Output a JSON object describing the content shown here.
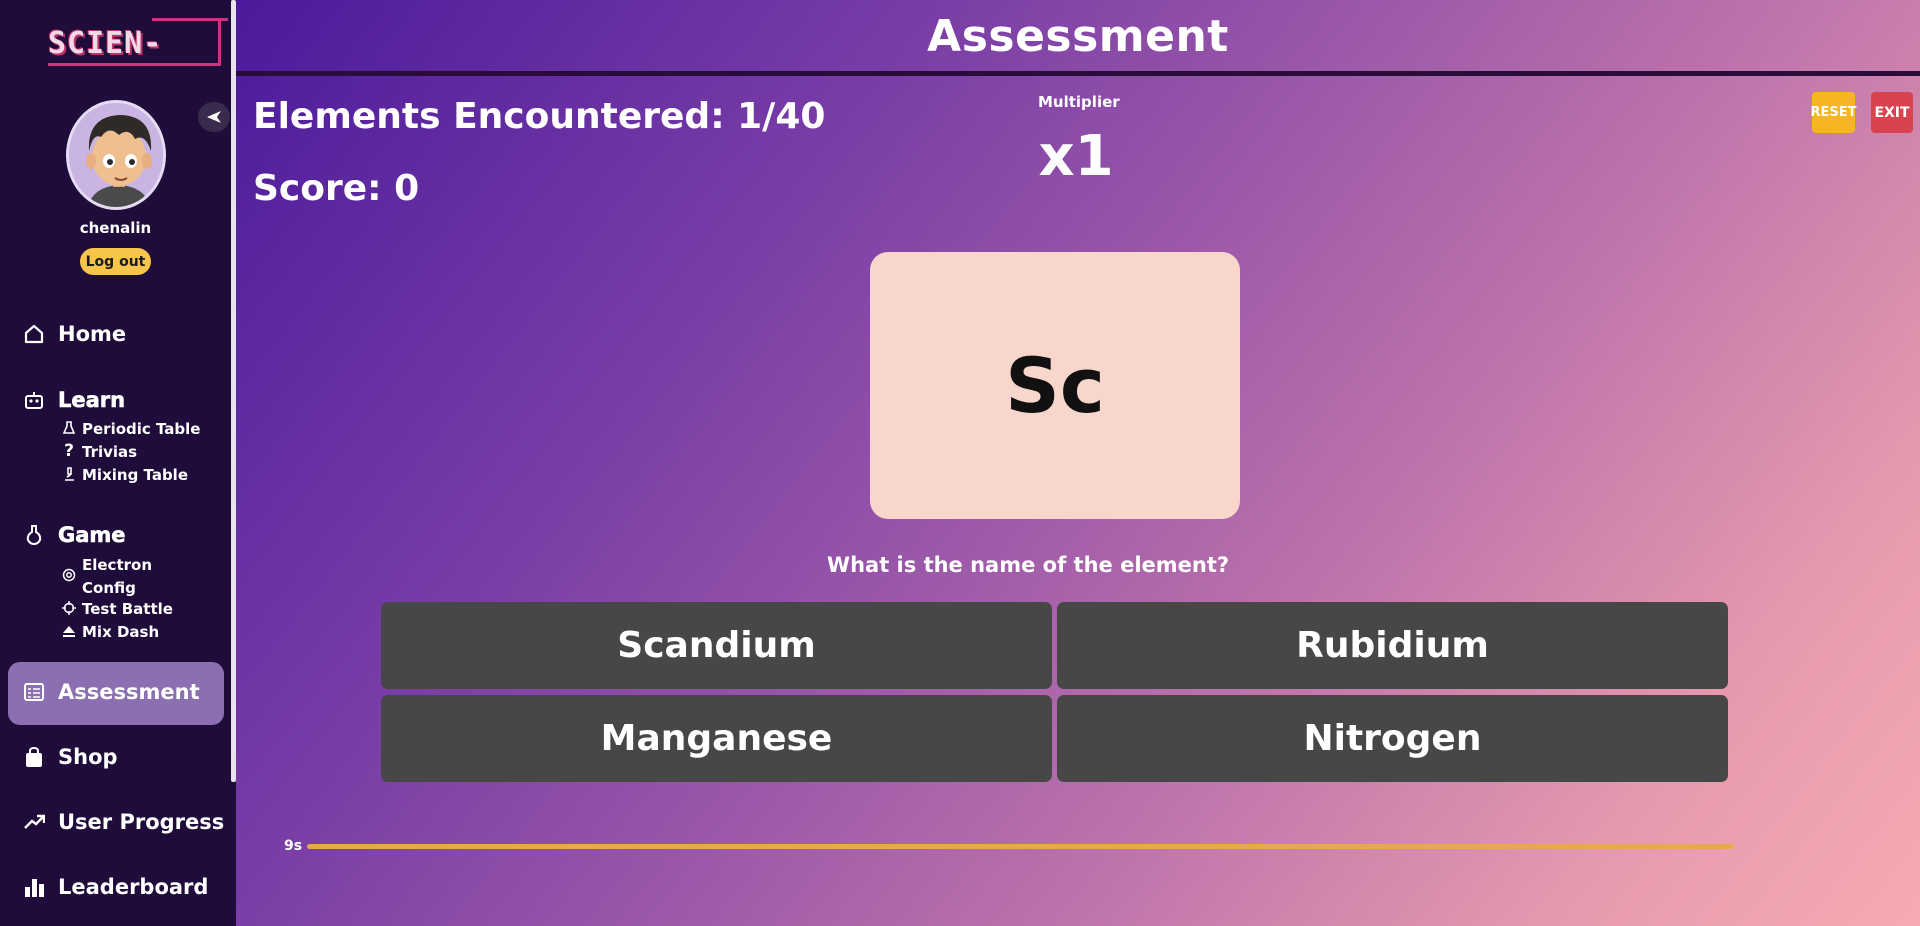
{
  "app": {
    "logo_text": "SCIEN-"
  },
  "user": {
    "username": "chenalin",
    "logout_label": "Log out"
  },
  "nav": {
    "home": "Home",
    "learn": {
      "label": "Learn",
      "items": [
        "Periodic Table",
        "Trivias",
        "Mixing Table"
      ]
    },
    "game": {
      "label": "Game",
      "items": [
        "Electron",
        "Config",
        "Test Battle",
        "Mix Dash"
      ]
    },
    "assessment": "Assessment",
    "shop": "Shop",
    "user_progress": "User Progress",
    "leaderboard": "Leaderboard"
  },
  "page": {
    "title": "Assessment",
    "elements_encountered": "Elements Encountered: 1/40",
    "score": "Score: 0",
    "multiplier_label": "Multiplier",
    "multiplier_value": "x1",
    "reset_label": "RESET",
    "exit_label": "EXIT"
  },
  "quiz": {
    "symbol": "Sc",
    "question": "What is the name of the element?",
    "answers": [
      "Scandium",
      "Rubidium",
      "Manganese",
      "Nitrogen"
    ],
    "timer_label": "9s",
    "timer_progress": 1.0
  },
  "colors": {
    "reset": "#f6b623",
    "exit": "#d9434f",
    "card": "#f9d6cc",
    "answer_bg": "#474747",
    "timer_bar": "#e8a94c",
    "active_nav": "#8b6fb0"
  }
}
